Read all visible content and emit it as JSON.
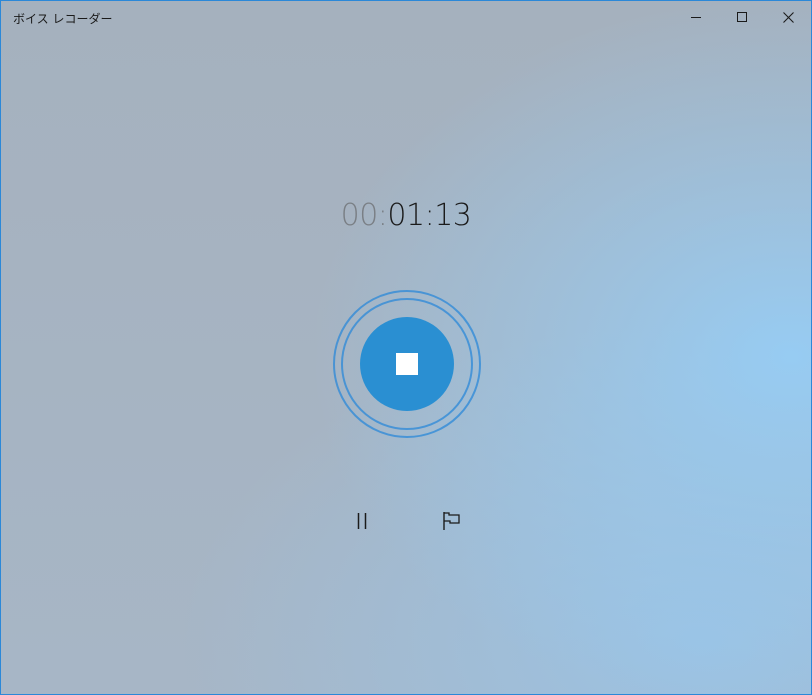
{
  "window": {
    "title": "ボイス レコーダー",
    "controls": {
      "minimize_icon": "minimize-icon",
      "maximize_icon": "maximize-icon",
      "close_icon": "close-icon"
    }
  },
  "recorder": {
    "timer": {
      "hours": "00",
      "sep1": ":",
      "minutes": "01",
      "sep2": ":",
      "seconds": "13"
    },
    "stop_icon": "stop-icon",
    "pause_icon": "pause-icon",
    "marker_icon": "flag-icon"
  },
  "colors": {
    "accent": "#2a8fd2",
    "window_border": "#2b88d8",
    "timer_dim": "#7a7f85",
    "timer_bright": "#1b1b1b"
  }
}
